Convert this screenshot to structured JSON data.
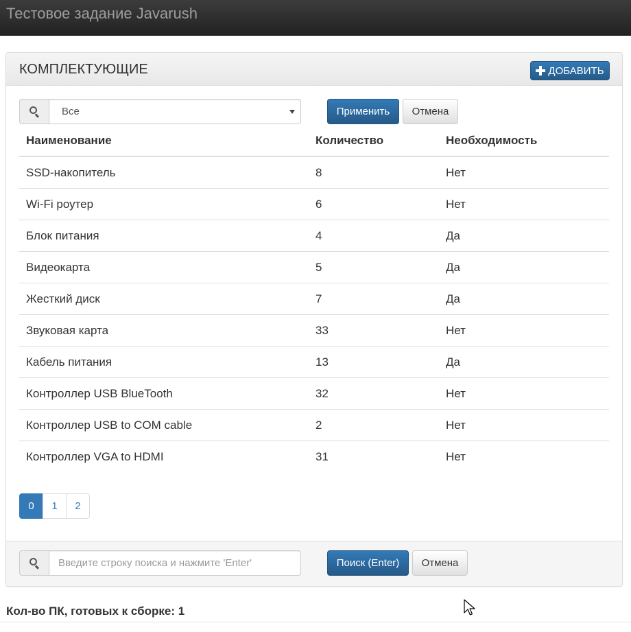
{
  "navbar": {
    "brand": "Тестовое задание Javarush"
  },
  "panel": {
    "title": "КОМПЛЕКТУЮЩИЕ",
    "add_label": "ДОБАВИТЬ"
  },
  "filter": {
    "selected": "Все",
    "apply_label": "Применить",
    "cancel_label": "Отмена"
  },
  "table": {
    "headers": [
      "Наименование",
      "Количество",
      "Необходимость"
    ],
    "rows": [
      [
        "SSD-накопитель",
        "8",
        "Нет"
      ],
      [
        "Wi-Fi роутер",
        "6",
        "Нет"
      ],
      [
        "Блок питания",
        "4",
        "Да"
      ],
      [
        "Видеокарта",
        "5",
        "Да"
      ],
      [
        "Жесткий диск",
        "7",
        "Да"
      ],
      [
        "Звуковая карта",
        "33",
        "Нет"
      ],
      [
        "Кабель питания",
        "13",
        "Да"
      ],
      [
        "Контроллер USB BlueTooth",
        "32",
        "Нет"
      ],
      [
        "Контроллер USB to COM cable",
        "2",
        "Нет"
      ],
      [
        "Контроллер VGA to HDMI",
        "31",
        "Нет"
      ]
    ]
  },
  "pagination": {
    "pages": [
      "0",
      "1",
      "2"
    ],
    "active": "0"
  },
  "search": {
    "placeholder": "Введите строку поиска и нажмите 'Enter'",
    "search_label": "Поиск (Enter)",
    "cancel_label": "Отмена"
  },
  "summary": "Кол-во ПК, готовых к сборке: 1"
}
